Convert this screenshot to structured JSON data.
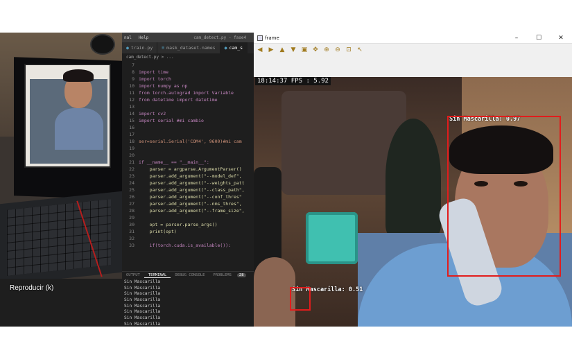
{
  "player": {
    "play_tooltip": "Reproducir (k)"
  },
  "editor": {
    "menu": [
      "nal",
      "Help"
    ],
    "title": "cam_detect.py - fase4",
    "tabs": [
      {
        "label": "train.py",
        "active": false
      },
      {
        "label": "mask_dataset.names",
        "active": false
      },
      {
        "label": "cam_s",
        "active": true
      }
    ],
    "breadcrumb": "cam_detect.py > ...",
    "code_lines": [
      {
        "n": "7",
        "text": ""
      },
      {
        "n": "8",
        "text": "import time",
        "cls": "kw"
      },
      {
        "n": "9",
        "text": "import torch",
        "cls": "kw"
      },
      {
        "n": "10",
        "text": "import numpy as np",
        "cls": "kw"
      },
      {
        "n": "11",
        "text": "from torch.autograd import Variable",
        "cls": "kw"
      },
      {
        "n": "12",
        "text": "from datetime import datetime",
        "cls": "kw"
      },
      {
        "n": "13",
        "text": ""
      },
      {
        "n": "14",
        "text": "import cv2",
        "cls": "kw"
      },
      {
        "n": "15",
        "text": "import serial #mi cambio",
        "cls": "kw"
      },
      {
        "n": "16",
        "text": ""
      },
      {
        "n": "17",
        "text": ""
      },
      {
        "n": "18",
        "text": "ser=serial.Serial('COM4', 9600)#mi cam",
        "cls": "str"
      },
      {
        "n": "19",
        "text": ""
      },
      {
        "n": "20",
        "text": ""
      },
      {
        "n": "21",
        "text": "if __name__ == \"__main__\":",
        "cls": "kw"
      },
      {
        "n": "22",
        "text": "    parser = argparse.ArgumentParser()",
        "cls": "fn"
      },
      {
        "n": "23",
        "text": "    parser.add_argument(\"--model_def\",",
        "cls": "fn"
      },
      {
        "n": "24",
        "text": "    parser.add_argument(\"--weights_patt",
        "cls": "fn"
      },
      {
        "n": "25",
        "text": "    parser.add_argument(\"--class_path\",",
        "cls": "fn"
      },
      {
        "n": "26",
        "text": "    parser.add_argument(\"--conf_thres\"",
        "cls": "fn"
      },
      {
        "n": "27",
        "text": "    parser.add_argument(\"--nms_thres\",",
        "cls": "fn"
      },
      {
        "n": "28",
        "text": "    parser.add_argument(\"--frame_size\",",
        "cls": "fn"
      },
      {
        "n": "29",
        "text": ""
      },
      {
        "n": "30",
        "text": "    opt = parser.parse_args()",
        "cls": "fn"
      },
      {
        "n": "31",
        "text": "    print(opt)",
        "cls": "fn"
      },
      {
        "n": "32",
        "text": ""
      },
      {
        "n": "33",
        "text": "    if(torch.cuda.is_available()):",
        "cls": "kw"
      }
    ],
    "panel_tabs": [
      "OUTPUT",
      "TERMINAL",
      "DEBUG CONSOLE",
      "PROBLEMS",
      "28"
    ],
    "terminal_lines": [
      "Sin Mascarilla",
      "Sin Mascarilla",
      "Sin Mascarilla",
      "Sin Mascarilla",
      "Sin Mascarilla",
      "Sin Mascarilla",
      "Sin Mascarilla",
      "Sin Mascarilla"
    ]
  },
  "frame_window": {
    "title": "frame",
    "controls": [
      "–",
      "☐",
      "✕"
    ],
    "toolbar_icons": [
      "arrow-left-icon",
      "arrow-right-icon",
      "arrow-up-icon",
      "arrow-down-icon",
      "save-icon",
      "pan-icon",
      "zoom-in-icon",
      "zoom-out-icon",
      "fit-icon",
      "pointer-icon"
    ],
    "overlay": {
      "timestamp": "18:14:37 FPS : 5.92",
      "detections": [
        {
          "label": "Sin Mascarilla: 0.97",
          "color": "#e21c1c"
        },
        {
          "label": "Sin Mascarilla: 0.51",
          "color": "#e21c1c"
        }
      ]
    }
  }
}
